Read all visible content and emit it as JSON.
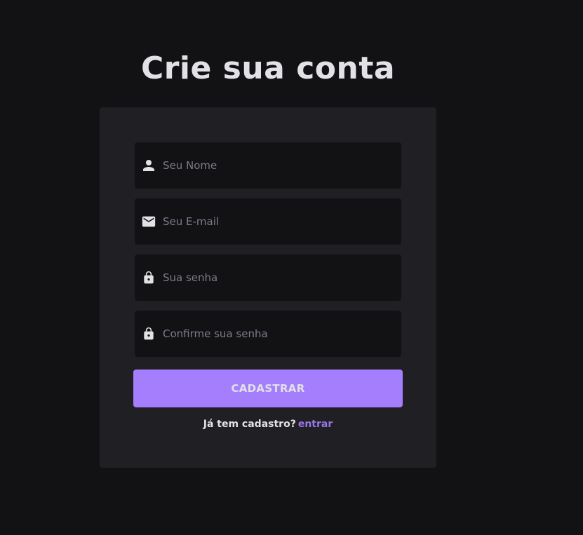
{
  "heading": "Crie sua conta",
  "form": {
    "name_placeholder": "Seu Nome",
    "email_placeholder": "Seu E-mail",
    "password_placeholder": "Sua senha",
    "confirm_placeholder": "Confirme sua senha",
    "submit_label": "CADASTRAR"
  },
  "footer": {
    "question": "Já tem cadastro?",
    "link_label": "entrar"
  },
  "icons": {
    "name": "person-icon",
    "email": "mail-icon",
    "password": "lock-icon",
    "confirm": "lock-icon"
  },
  "colors": {
    "background": "#121214",
    "card": "#202024",
    "input": "#121214",
    "accent": "#a47efc",
    "link": "#9875e8",
    "text": "#e1e1e6",
    "placeholder": "#7c7c8a"
  }
}
